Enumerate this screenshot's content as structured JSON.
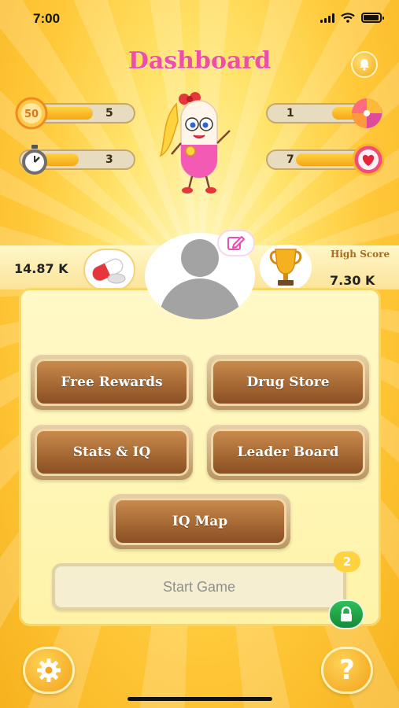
{
  "status_bar": {
    "time": "7:00"
  },
  "header": {
    "title": "Dashboard"
  },
  "stats": {
    "level_icon_text": "50",
    "level_value": "5",
    "timer_value": "3",
    "spin_value": "1",
    "lives_value": "7"
  },
  "scores": {
    "coins": "14.87 K",
    "high_score_label": "High Score",
    "high_score": "7.30 K"
  },
  "menu": {
    "free_rewards": "Free Rewards",
    "drug_store": "Drug Store",
    "stats_iq": "Stats & IQ",
    "leader_board": "Leader Board",
    "iq_map": "IQ Map"
  },
  "start": {
    "label": "Start Game",
    "badge": "2"
  },
  "footer": {
    "help_glyph": "?"
  },
  "colors": {
    "title": "#ee4ea5",
    "button_brown": "#8a4f22",
    "lock_green": "#1ea547",
    "accent_yellow": "#ffd23f"
  },
  "icons": [
    "bell-icon",
    "level-50-icon",
    "stopwatch-icon",
    "spin-wheel-icon",
    "heart-icon",
    "pill-icon",
    "trophy-icon",
    "edit-icon",
    "lock-icon",
    "gear-icon",
    "question-icon"
  ]
}
